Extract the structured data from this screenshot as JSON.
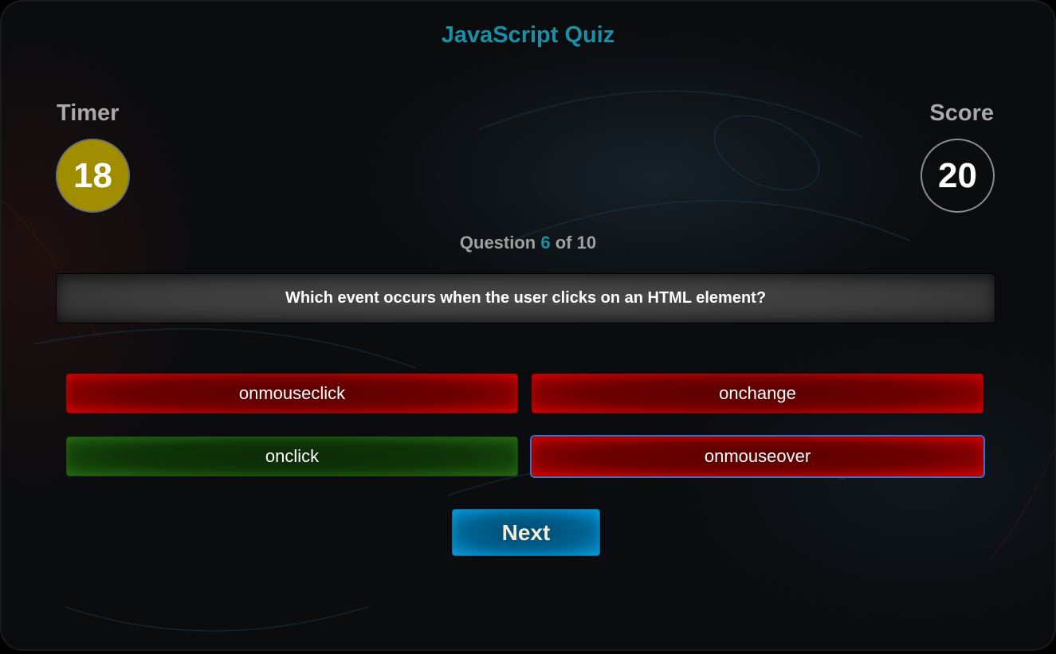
{
  "app": {
    "title": "JavaScript Quiz"
  },
  "timer": {
    "label": "Timer",
    "value": "18"
  },
  "score": {
    "label": "Score",
    "value": "20"
  },
  "progress": {
    "prefix": "Question",
    "current": "6",
    "separator": "of",
    "total": "10"
  },
  "question": {
    "text": "Which event occurs when the user clicks on an HTML element?"
  },
  "options": [
    {
      "label": "onmouseclick",
      "state": "wrong"
    },
    {
      "label": "onchange",
      "state": "wrong"
    },
    {
      "label": "onclick",
      "state": "correct"
    },
    {
      "label": "onmouseover",
      "state": "wrong-selected"
    }
  ],
  "actions": {
    "next_label": "Next"
  },
  "colors": {
    "accent": "#1b8fa6",
    "timer_fill": "#a08d00",
    "wrong": "#b30000",
    "correct": "#1d5a0e",
    "next": "#0b8ccc"
  }
}
